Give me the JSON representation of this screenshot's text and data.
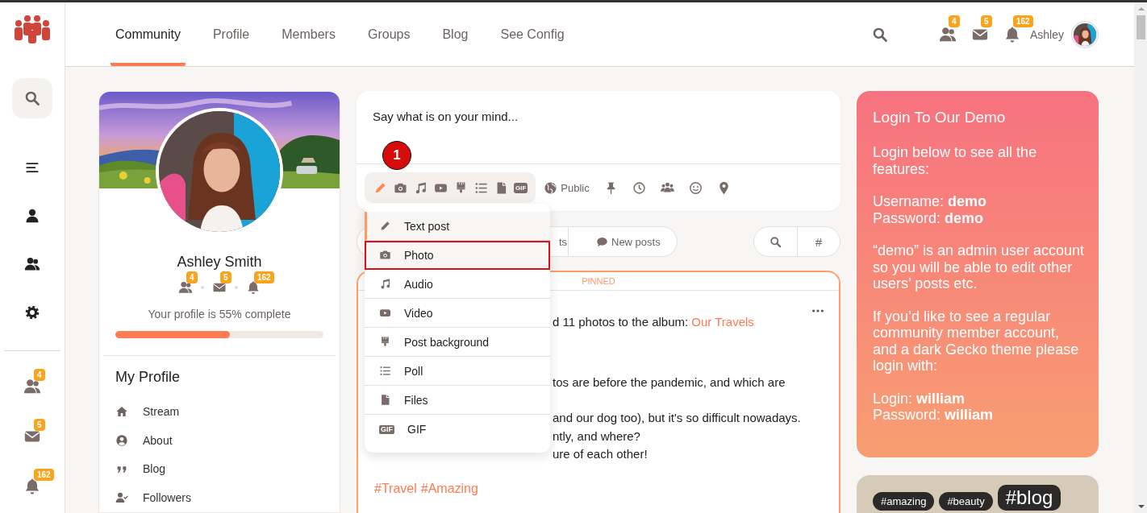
{
  "rail": {
    "nav_buttons": [
      {
        "selected": true
      },
      {
        "selected": false
      },
      {
        "selected": false
      },
      {
        "selected": false
      },
      {
        "selected": false
      }
    ],
    "counters": [
      {
        "count": "4"
      },
      {
        "count": "5"
      },
      {
        "count": "162"
      }
    ]
  },
  "nav": {
    "tabs": [
      {
        "label": "Community",
        "selected": true
      },
      {
        "label": "Profile",
        "selected": false
      },
      {
        "label": "Members",
        "selected": false
      },
      {
        "label": "Groups",
        "selected": false
      },
      {
        "label": "Blog",
        "selected": false
      },
      {
        "label": "See Config",
        "selected": false
      }
    ]
  },
  "header": {
    "counters": [
      {
        "count": "4"
      },
      {
        "count": "5"
      },
      {
        "count": "162"
      }
    ],
    "user_name": "Ashley"
  },
  "profile": {
    "name": "Ashley Smith",
    "counters": [
      {
        "count": "4"
      },
      {
        "count": "5"
      },
      {
        "count": "162"
      }
    ],
    "completion_text": "Your profile is 55% complete",
    "level": 0.55,
    "menu_title": "My Profile",
    "menu": [
      {
        "label": "Stream"
      },
      {
        "label": "About"
      },
      {
        "label": "Blog"
      },
      {
        "label": "Followers"
      }
    ]
  },
  "composer": {
    "placeholder": "Say what is on your mind...",
    "step_marker": "1",
    "type_buttons": [
      {
        "selected": true
      },
      {
        "selected": false
      },
      {
        "selected": false
      },
      {
        "selected": false
      },
      {
        "selected": false
      },
      {
        "selected": false
      },
      {
        "selected": false
      },
      {
        "selected": false,
        "label": "GIF"
      }
    ],
    "privacy": "Public"
  },
  "type_menu": {
    "items": [
      {
        "label": "Text post",
        "selected": true,
        "highlighted": false
      },
      {
        "label": "Photo",
        "selected": false,
        "highlighted": true
      },
      {
        "label": "Audio",
        "selected": false,
        "highlighted": false
      },
      {
        "label": "Video",
        "selected": false,
        "highlighted": false
      },
      {
        "label": "Post background",
        "selected": false,
        "highlighted": false
      },
      {
        "label": "Poll",
        "selected": false,
        "highlighted": false
      },
      {
        "label": "Files",
        "selected": false,
        "highlighted": false
      },
      {
        "label": "GIF",
        "selected": false,
        "highlighted": false,
        "badge": "GIF"
      }
    ]
  },
  "filters": {
    "tabs": [
      {
        "label": "ts"
      },
      {
        "label": "New posts"
      }
    ],
    "hash_button": "#"
  },
  "post": {
    "pinned_label": "PINNED",
    "paragraphs": [
      [
        "d 11 photos to the album: "
      ],
      [
        "tos are before the pandemic, and which are"
      ],
      [
        "and our dog too), but it's so difficult nowadays.",
        "ntly, and where?",
        "ure of each other!"
      ]
    ],
    "album_link": "Our Travels",
    "hashtags": [
      "#Travel",
      "#Amazing"
    ]
  },
  "login_card": {
    "title": "Login To Our Demo",
    "paragraphs": [
      "Login below to see all the features:",
      "Username: **demo**\nPassword: **demo**",
      "“demo” is an admin user account so you will be able to edit other users’ posts etc.",
      "If you’d like to see a regular community member account, and a dark Gecko theme please login with:",
      "Login: **william**\nPassword: **william**"
    ]
  },
  "tag_cloud": [
    {
      "label": "#amazing",
      "kind": "small"
    },
    {
      "label": "#beauty",
      "kind": "small"
    },
    {
      "label": "#blog",
      "kind": "large"
    }
  ]
}
